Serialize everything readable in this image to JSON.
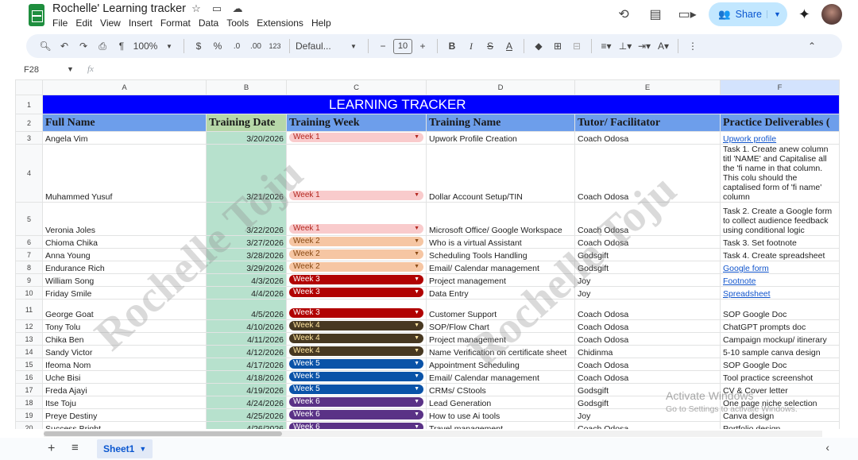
{
  "app": {
    "doc_title": "Rochelle' Learning tracker",
    "menu": [
      "File",
      "Edit",
      "View",
      "Insert",
      "Format",
      "Data",
      "Tools",
      "Extensions",
      "Help"
    ],
    "share_label": "Share"
  },
  "toolbar": {
    "zoom": "100%",
    "currency": "$",
    "percent": "%",
    "dec_decrease": ".0",
    "dec_increase": ".00",
    "number_format": "123",
    "font": "Defaul...",
    "font_size": "10",
    "bold": "B",
    "italic": "I",
    "text_color": "A"
  },
  "formula_bar": {
    "cell_ref": "F28",
    "fx": "fx",
    "value": ""
  },
  "columns": [
    "A",
    "B",
    "C",
    "D",
    "E",
    "F"
  ],
  "selected_column": "F",
  "sheet": {
    "banner": "LEARNING TRACKER",
    "headers": [
      "Full Name",
      "Training Date",
      "Training Week",
      "Training Name",
      "Tutor/ Facilitator",
      "Practice Deliverables ("
    ],
    "rows": [
      {
        "n": "3",
        "name": "Angela Vim",
        "date": "3/20/2026",
        "week": "Week 1",
        "wk": "w1",
        "training": "Upwork Profile Creation",
        "tutor": "Coach Odosa",
        "deliverable": "Upwork profile",
        "link": true
      },
      {
        "n": "4",
        "name": "Muhammed Yusuf",
        "date": "3/21/2026",
        "week": "Week 1",
        "wk": "w1",
        "training": "Dollar Account Setup/TIN",
        "tutor": "Coach Odosa",
        "deliverable": "Task 1. Create anew column titl 'NAME' and Capitalise all the 'fi name in that column. This colu should the captalised form of 'fi name' column",
        "link": false
      },
      {
        "n": "5",
        "name": "Veronia Joles",
        "date": "3/22/2026",
        "week": "Week 1",
        "wk": "w1",
        "training": "Microsoft Office/ Google Workspace",
        "tutor": "Coach Odosa",
        "deliverable": "Task 2. Create a Google form to collect audience feedback using conditional logic",
        "link": false
      },
      {
        "n": "6",
        "name": "Chioma Chika",
        "date": "3/27/2026",
        "week": "Week 2",
        "wk": "w2",
        "training": "Who is a virtual Assistant",
        "tutor": "Coach Odosa",
        "deliverable": "Task 3. Set footnote",
        "link": false
      },
      {
        "n": "7",
        "name": "Anna Young",
        "date": "3/28/2026",
        "week": "Week 2",
        "wk": "w2",
        "training": "Scheduling Tools Handling",
        "tutor": "Godsgift",
        "deliverable": "Task 4. Create spreadsheet",
        "link": false
      },
      {
        "n": "8",
        "name": "Endurance Rich",
        "date": "3/29/2026",
        "week": "Week 2",
        "wk": "w2",
        "training": "Email/ Calendar management",
        "tutor": "Godsgift",
        "deliverable": "Google form",
        "link": true
      },
      {
        "n": "9",
        "name": "William Song",
        "date": "4/3/2026",
        "week": "Week 3",
        "wk": "w3",
        "training": "Project management",
        "tutor": "Joy",
        "deliverable": "Footnote",
        "link": true
      },
      {
        "n": "10",
        "name": "Friday Smile",
        "date": "4/4/2026",
        "week": "Week 3",
        "wk": "w3",
        "training": "Data Entry",
        "tutor": "Joy",
        "deliverable": "Spreadsheet",
        "link": true
      },
      {
        "n": "11",
        "name": "George Goat",
        "date": "4/5/2026",
        "week": "Week 3",
        "wk": "w3",
        "training": "Customer Support",
        "tutor": "Coach Odosa",
        "deliverable": "SOP Google Doc",
        "link": false
      },
      {
        "n": "12",
        "name": "Tony Tolu",
        "date": "4/10/2026",
        "week": "Week 4",
        "wk": "w4",
        "training": "SOP/Flow Chart",
        "tutor": "Coach Odosa",
        "deliverable": "ChatGPT prompts doc",
        "link": false
      },
      {
        "n": "13",
        "name": "Chika Ben",
        "date": "4/11/2026",
        "week": "Week 4",
        "wk": "w4",
        "training": "Project management",
        "tutor": "Coach Odosa",
        "deliverable": "Campaign mockup/ itinerary",
        "link": false
      },
      {
        "n": "14",
        "name": "Sandy Victor",
        "date": "4/12/2026",
        "week": "Week 4",
        "wk": "w4",
        "training": "Name Verification on certificate sheet",
        "tutor": "Chidinma",
        "deliverable": "5-10 sample canva design",
        "link": false
      },
      {
        "n": "15",
        "name": "Ifeoma Nom",
        "date": "4/17/2026",
        "week": "Week 5",
        "wk": "w5",
        "training": "Appointment Scheduling",
        "tutor": "Coach Odosa",
        "deliverable": "SOP Google Doc",
        "link": false
      },
      {
        "n": "16",
        "name": "Uche Bisi",
        "date": "4/18/2026",
        "week": "Week 5",
        "wk": "w5",
        "training": "Email/ Calendar management",
        "tutor": "Coach Odosa",
        "deliverable": "Tool practice screenshot",
        "link": false
      },
      {
        "n": "17",
        "name": "Freda Ajayi",
        "date": "4/19/2026",
        "week": "Week 5",
        "wk": "w5",
        "training": "CRMs/ CStools",
        "tutor": "Godsgift",
        "deliverable": "CV & Cover letter",
        "link": false
      },
      {
        "n": "18",
        "name": "Itse Toju",
        "date": "4/24/2026",
        "week": "Week 6",
        "wk": "w6",
        "training": "Lead Generation",
        "tutor": "Godsgift",
        "deliverable": "One page niche selection",
        "link": false
      },
      {
        "n": "19",
        "name": "Preye Destiny",
        "date": "4/25/2026",
        "week": "Week 6",
        "wk": "w6",
        "training": "How to use Ai tools",
        "tutor": "Joy",
        "deliverable": "Canva design",
        "link": false
      },
      {
        "n": "20",
        "name": "Success Bright",
        "date": "4/26/2026",
        "week": "Week 6",
        "wk": "w6",
        "training": "Travel management",
        "tutor": "Coach Odosa",
        "deliverable": "Portfolio design",
        "link": false
      }
    ]
  },
  "watermark": [
    "Rochelle Toju",
    "Rochelle Toju"
  ],
  "windows_notice": {
    "title": "Activate Windows",
    "sub": "Go to Settings to activate Windows."
  },
  "tabs": {
    "active": "Sheet1"
  },
  "colors": {
    "banner": "#0000ff",
    "header": "#6d9eeb",
    "date_column": "#b7e1cd",
    "week1": "#f9cbcc",
    "week2": "#f6c6a3",
    "week3": "#b10202",
    "week4": "#473821",
    "week5": "#0a53a8",
    "week6": "#5a3286"
  }
}
